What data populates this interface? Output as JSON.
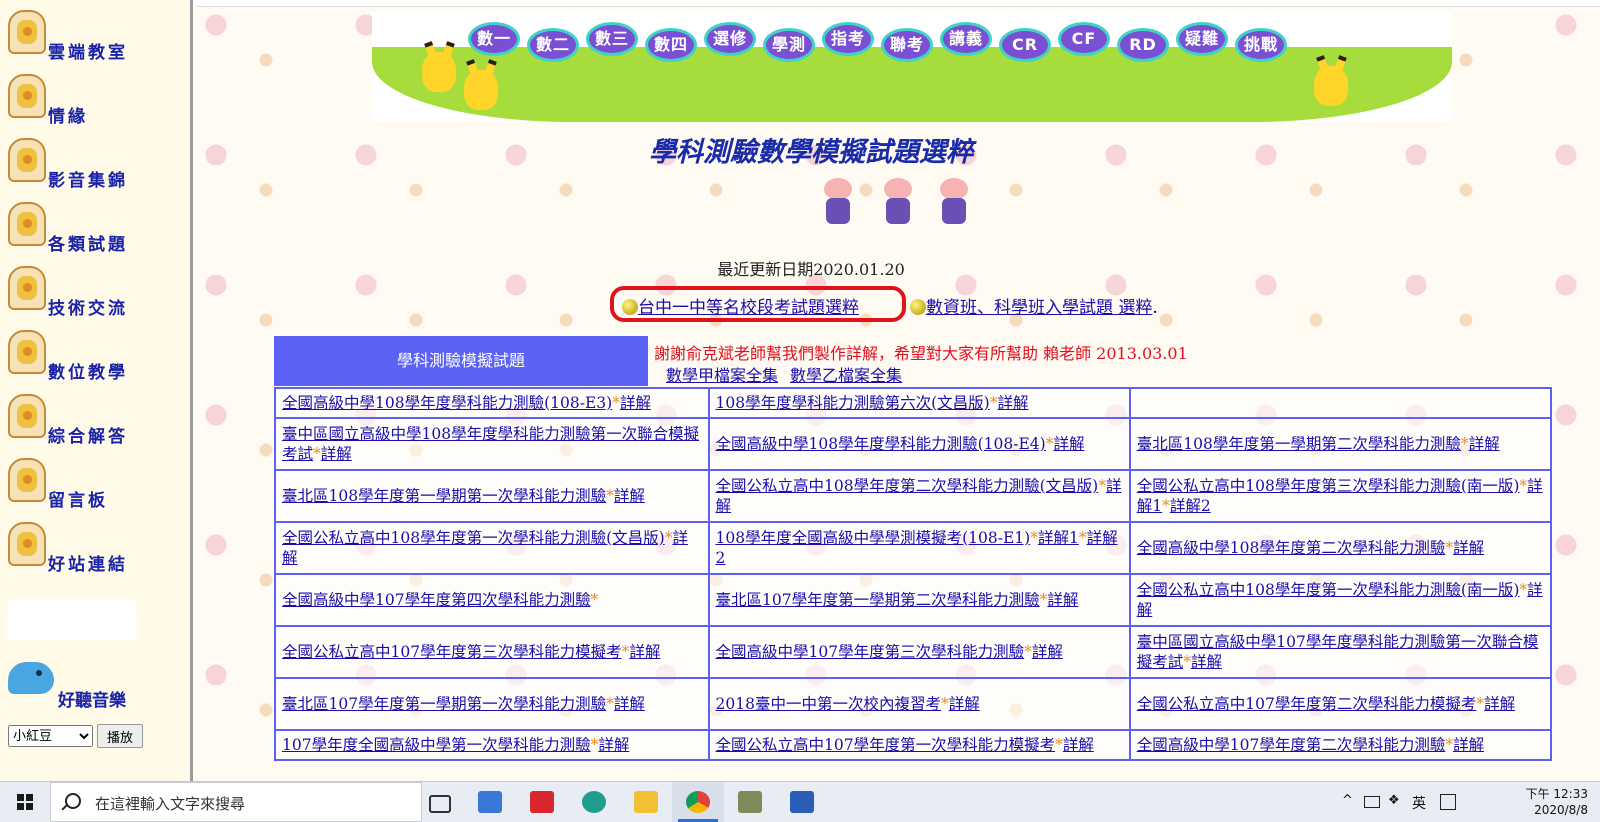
{
  "left_nav": {
    "items": [
      {
        "label": "雲端教室"
      },
      {
        "label": "情緣"
      },
      {
        "label": "影音集錦"
      },
      {
        "label": "各類試題"
      },
      {
        "label": "技術交流"
      },
      {
        "label": "數位教學"
      },
      {
        "label": "綜合解答"
      },
      {
        "label": "留言板"
      },
      {
        "label": "好站連結"
      }
    ],
    "music_label": "好聽音樂",
    "music_select_value": "小紅豆",
    "play_button": "播放"
  },
  "banner": {
    "buttons": [
      "數一",
      "數二",
      "數三",
      "數四",
      "選修",
      "學測",
      "指考",
      "聯考",
      "講義",
      "CR",
      "CF",
      "RD",
      "疑難",
      "挑戰"
    ]
  },
  "page_title": "學科測驗數學模擬試題選粹",
  "update_text": "最近更新日期2020.01.20",
  "top_links": {
    "link1": "台中一中等名校段考試題選粹",
    "link2": "數資班、科學班入學試題 選粹"
  },
  "table_header": "學科測驗模擬試題",
  "thanks_text": "謝謝俞克斌老師幫我們製作詳解，希望對大家有所幫助 賴老師 2013.03.01",
  "downloads": [
    "數學甲檔案全集",
    "數學乙檔案全集"
  ],
  "rows": [
    [
      {
        "title": "全國高級中學108學年度學科能力測驗(108-E3)",
        "star": "*",
        "links": [
          "詳解"
        ]
      },
      {
        "title": "108學年度學科能力測驗第六次(文昌版)",
        "star": "*",
        "links": [
          "詳解"
        ]
      },
      {
        "title": "",
        "star": "",
        "links": []
      }
    ],
    [
      {
        "title": "臺中區國立高級中學108學年度學科能力測驗第一次聯合模擬考試",
        "star": "*",
        "links": [
          "詳解"
        ]
      },
      {
        "title": "全國高級中學108學年度學科能力測驗(108-E4)",
        "star": "*",
        "links": [
          "詳解"
        ]
      },
      {
        "title": "臺北區108學年度第一學期第二次學科能力測驗",
        "star": "*",
        "links": [
          "詳解"
        ]
      }
    ],
    [
      {
        "title": "臺北區108學年度第一學期第一次學科能力測驗",
        "star": "*",
        "links": [
          "詳解"
        ]
      },
      {
        "title": "全國公私立高中108學年度第二次學科能力測驗(文昌版)",
        "star": "*",
        "links": [
          "詳解"
        ]
      },
      {
        "title": "全國公私立高中108學年度第三次學科能力測驗(南一版)",
        "star": "*",
        "links": [
          "詳解1",
          "詳解2"
        ]
      }
    ],
    [
      {
        "title": "全國公私立高中108學年度第一次學科能力測驗(文昌版)",
        "star": "*",
        "links": [
          "詳解"
        ]
      },
      {
        "title": "108學年度全國高級中學學測模擬考(108-E1)",
        "star": "*",
        "links": [
          "詳解1",
          "詳解2"
        ]
      },
      {
        "title": "全國高級中學108學年度第二次學科能力測驗",
        "star": "*",
        "links": [
          "詳解"
        ]
      }
    ],
    [
      {
        "title": "全國高級中學107學年度第四次學科能力測驗",
        "star": "*",
        "links": []
      },
      {
        "title": "臺北區107學年度第一學期第二次學科能力測驗",
        "star": "*",
        "links": [
          "詳解"
        ]
      },
      {
        "title": "全國公私立高中108學年度第一次學科能力測驗(南一版)",
        "star": "*",
        "links": [
          "詳解"
        ]
      }
    ],
    [
      {
        "title": "全國公私立高中107學年度第三次學科能力模擬考",
        "star": "*",
        "links": [
          "詳解"
        ]
      },
      {
        "title": "全國高級中學107學年度第三次學科能力測驗",
        "star": "*",
        "links": [
          "詳解"
        ]
      },
      {
        "title": "臺中區國立高級中學107學年度學科能力測驗第一次聯合模擬考試",
        "star": "*",
        "links": [
          "詳解"
        ]
      }
    ],
    [
      {
        "title": "臺北區107學年度第一學期第一次學科能力測驗",
        "star": "*",
        "links": [
          "詳解"
        ]
      },
      {
        "title": "2018臺中一中第一次校內複習考",
        "star": "*",
        "links": [
          "詳解"
        ]
      },
      {
        "title": "全國公私立高中107學年度第二次學科能力模擬考",
        "star": "*",
        "links": [
          "詳解"
        ]
      }
    ],
    [
      {
        "title": "107學年度全國高級中學第一次學科能力測驗",
        "star": "*",
        "links": [
          "詳解"
        ]
      },
      {
        "title": "全國公私立高中107學年度第一次學科能力模擬考",
        "star": "*",
        "links": [
          "詳解"
        ]
      },
      {
        "title": "全國高級中學107學年度第二次學科能力測驗",
        "star": "*",
        "links": [
          "詳解"
        ]
      }
    ]
  ],
  "taskbar": {
    "search_placeholder": "在這裡輸入文字來搜尋",
    "apps": [
      "task-view-icon",
      "store-icon",
      "gift-icon",
      "edge-icon",
      "file-explorer-icon",
      "chrome-icon",
      "books-icon",
      "word-icon"
    ],
    "ime": "英",
    "time": "下午 12:33",
    "date": "2020/8/8"
  },
  "colors": {
    "nav_text": "#1a22a8",
    "table_border": "#5b62f5",
    "highlight_circle": "#e0121c",
    "thanks_red": "#e01020",
    "banner_button": "#7a4fd3"
  }
}
